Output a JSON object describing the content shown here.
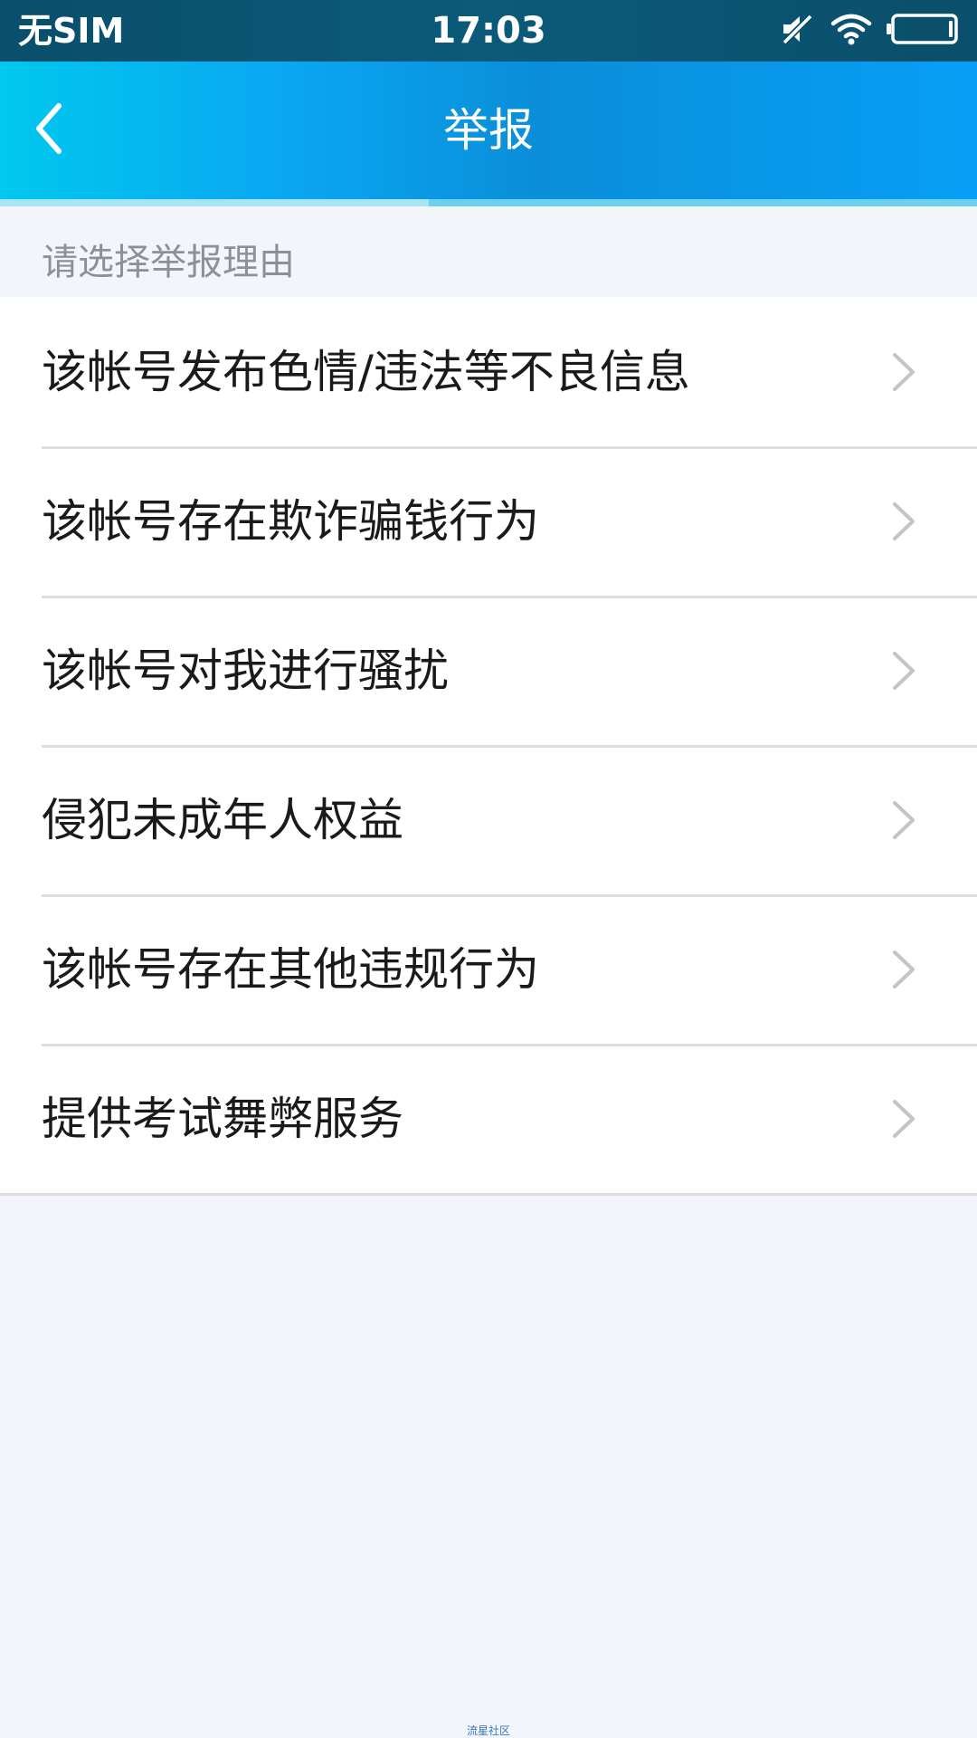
{
  "status_bar": {
    "carrier": "无SIM",
    "time": "17:03",
    "icons": [
      "mute-icon",
      "wifi-icon",
      "battery-icon"
    ]
  },
  "nav": {
    "title": "举报",
    "back_icon": "back-chevron-icon"
  },
  "section_label": "请选择举报理由",
  "reasons": [
    {
      "label": "该帐号发布色情/违法等不良信息",
      "icon": "chevron-right-icon"
    },
    {
      "label": "该帐号存在欺诈骗钱行为",
      "icon": "chevron-right-icon"
    },
    {
      "label": "该帐号对我进行骚扰",
      "icon": "chevron-right-icon"
    },
    {
      "label": "侵犯未成年人权益",
      "icon": "chevron-right-icon"
    },
    {
      "label": "该帐号存在其他违规行为",
      "icon": "chevron-right-icon"
    },
    {
      "label": "提供考试舞弊服务",
      "icon": "chevron-right-icon"
    }
  ],
  "watermark": "流星社区",
  "colors": {
    "header_start": "#00c8ee",
    "header_end": "#079ff6",
    "status_bar": "#0a4f6b",
    "page_background": "#f2f5f9",
    "list_text": "#1a1a1a",
    "section_label": "#8c9196",
    "chevron": "#c4c4c4"
  }
}
